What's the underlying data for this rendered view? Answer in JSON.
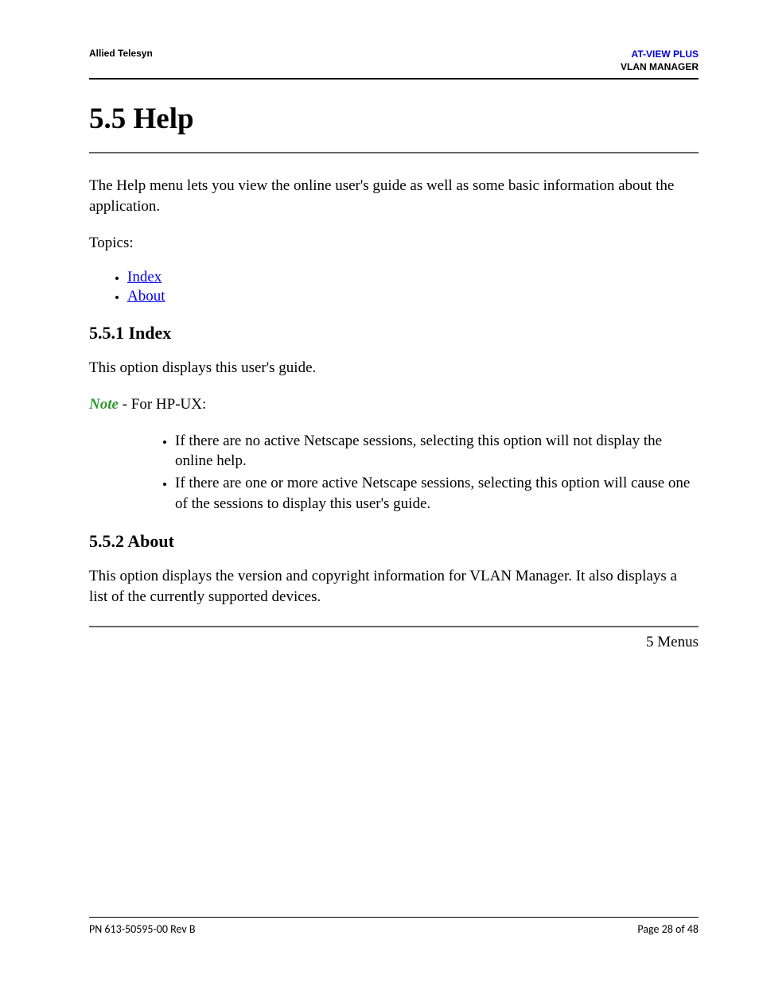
{
  "header": {
    "left": "Allied Telesyn",
    "right_line1": "AT-VIEW PLUS",
    "right_line2": "VLAN MANAGER"
  },
  "section": {
    "title": "5.5 Help",
    "intro": "The Help menu lets you view the online user's guide as well as some basic information about the application.",
    "topics_label": "Topics:",
    "topics": [
      {
        "label": "Index"
      },
      {
        "label": "About"
      }
    ]
  },
  "subsection_index": {
    "title": "5.5.1 Index",
    "body": "This option displays this user's guide.",
    "note_label": "Note",
    "note_rest": " - For HP-UX:",
    "bullets": [
      "If there are no active Netscape sessions, selecting this option will not display the online help.",
      "If there are one or more active Netscape sessions, selecting this option will cause one of the sessions to display this user's guide."
    ]
  },
  "subsection_about": {
    "title": "5.5.2 About",
    "body": "This option displays the version and copyright information for VLAN Manager. It also displays a list of the currently supported devices."
  },
  "chapter_foot": "5 Menus",
  "footer": {
    "left": "PN 613-50595-00 Rev B",
    "right": "Page 28 of 48"
  }
}
